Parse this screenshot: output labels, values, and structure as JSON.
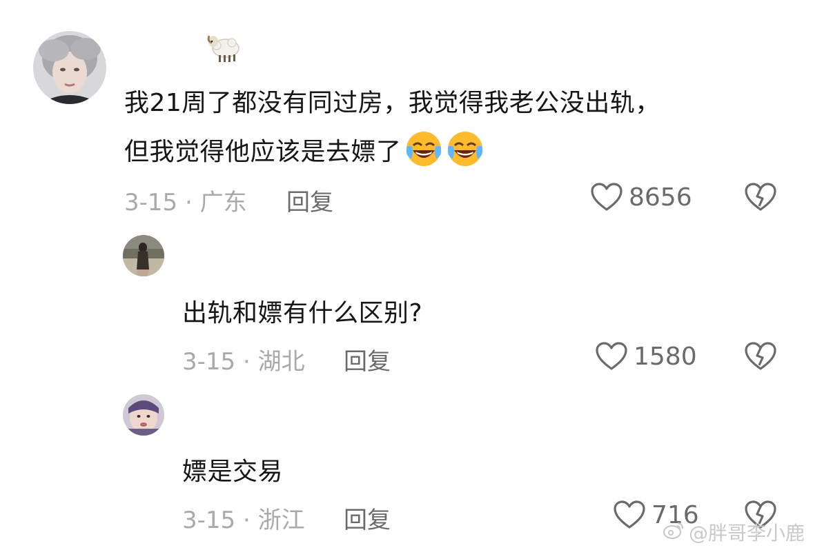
{
  "comments": [
    {
      "lines": [
        "我21周了都没有同过房，我觉得我老公没出轨，",
        "但我觉得他应该是去嫖了"
      ],
      "emoji": [
        "face-with-tears-of-joy",
        "face-with-tears-of-joy"
      ],
      "name_icon": "sheep-emoji",
      "date_location": "3-15 · 广东",
      "reply_label": "回复",
      "likes": "8656"
    },
    {
      "text": "出轨和嫖有什么区别?",
      "date_location": "3-15 · 湖北",
      "reply_label": "回复",
      "likes": "1580"
    },
    {
      "text": "嫖是交易",
      "date_location": "3-15 · 浙江",
      "reply_label": "回复",
      "likes": "716"
    }
  ],
  "watermark": {
    "text": "@胖哥李小鹿",
    "icon": "weibo-icon"
  },
  "colors": {
    "text": "#161616",
    "meta": "#a9a9a9",
    "action": "#6a6a6a",
    "watermark": "#c9c9c9"
  }
}
